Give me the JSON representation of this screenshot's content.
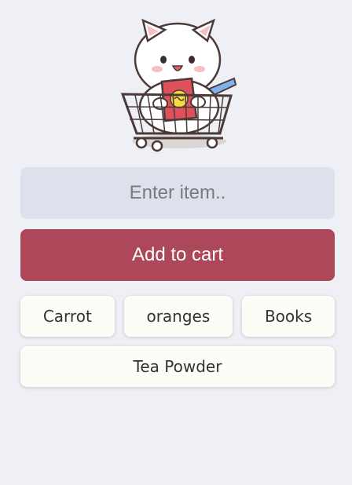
{
  "mascot": {
    "icon": "cat-in-shopping-cart-icon"
  },
  "input": {
    "placeholder": "Enter item..",
    "value": ""
  },
  "add_button": {
    "label": "Add to cart"
  },
  "items": [
    {
      "label": "Carrot"
    },
    {
      "label": "oranges"
    },
    {
      "label": "Books"
    },
    {
      "label": "Tea Powder"
    }
  ],
  "colors": {
    "background": "#eef0f5",
    "input_bg": "#dce1eb",
    "button_bg": "#ac485a",
    "chip_bg": "#fefcf6"
  }
}
